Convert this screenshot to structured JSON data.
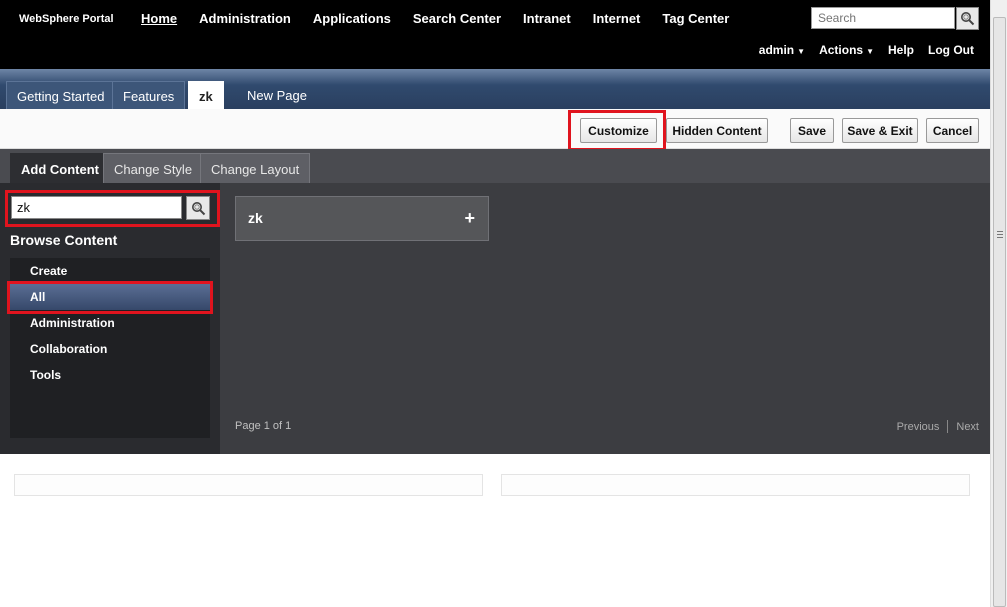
{
  "brand": "WebSphere Portal",
  "top_nav": [
    "Home",
    "Administration",
    "Applications",
    "Search Center",
    "Intranet",
    "Internet",
    "Tag Center"
  ],
  "search": {
    "placeholder": "Search"
  },
  "user_nav": {
    "user": "admin",
    "actions": "Actions",
    "help": "Help",
    "logout": "Log Out"
  },
  "page_tabs": [
    "Getting Started",
    "Features",
    "zk",
    "New Page"
  ],
  "action_buttons": {
    "customize": "Customize",
    "hidden_content": "Hidden Content",
    "save": "Save",
    "save_exit": "Save & Exit",
    "cancel": "Cancel"
  },
  "customize_tabs": [
    "Add Content",
    "Change Style",
    "Change Layout"
  ],
  "content_search": {
    "value": "zk"
  },
  "browse": {
    "title": "Browse Content",
    "categories": [
      "Create",
      "All",
      "Administration",
      "Collaboration",
      "Tools"
    ],
    "selected": "All"
  },
  "results": {
    "items": [
      {
        "title": "zk",
        "add_glyph": "+"
      }
    ],
    "page_info": "Page 1 of 1",
    "previous": "Previous",
    "next": "Next"
  },
  "colors": {
    "highlight": "#e0141e",
    "selected_item": "#4a5e84"
  }
}
